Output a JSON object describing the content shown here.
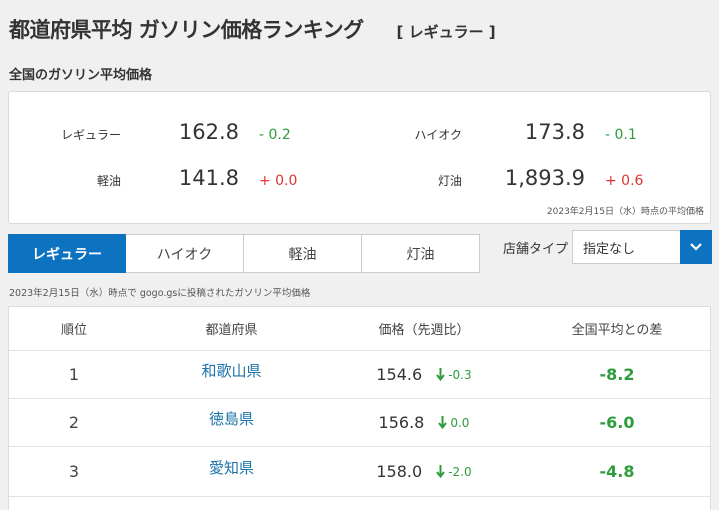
{
  "header": {
    "title": "都道府県平均 ガソリン価格ランキング",
    "tag": "[ レギュラー ]"
  },
  "summary": {
    "section_label": "全国のガソリン平均価格",
    "fuels": [
      {
        "name": "レギュラー",
        "price": "162.8",
        "diff": "- 0.2",
        "trend": "down"
      },
      {
        "name": "ハイオク",
        "price": "173.8",
        "diff": "- 0.1",
        "trend": "down"
      },
      {
        "name": "軽油",
        "price": "141.8",
        "diff": "+ 0.0",
        "trend": "up"
      },
      {
        "name": "灯油",
        "price": "1,893.9",
        "diff": "+ 0.6",
        "trend": "up"
      }
    ],
    "as_of": "2023年2月15日（水）時点の平均価格"
  },
  "tabs": [
    {
      "label": "レギュラー",
      "active": true
    },
    {
      "label": "ハイオク",
      "active": false
    },
    {
      "label": "軽油",
      "active": false
    },
    {
      "label": "灯油",
      "active": false
    }
  ],
  "shop_filter": {
    "label": "店舗タイプ",
    "selected": "指定なし"
  },
  "note": "2023年2月15日（水）時点で gogo.gsに投稿されたガソリン平均価格",
  "table": {
    "headers": [
      "順位",
      "都道府県",
      "価格（先週比）",
      "全国平均との差"
    ],
    "rows": [
      {
        "rank": "1",
        "prefecture": "和歌山県",
        "price": "154.6",
        "week_change": "-0.3",
        "diff": "-8.2"
      },
      {
        "rank": "2",
        "prefecture": "徳島県",
        "price": "156.8",
        "week_change": "0.0",
        "diff": "-6.0"
      },
      {
        "rank": "3",
        "prefecture": "愛知県",
        "price": "158.0",
        "week_change": "-2.0",
        "diff": "-4.8"
      }
    ]
  },
  "colors": {
    "accent": "#0d72bf",
    "decrease": "#2e9c3d",
    "increase": "#dd3333",
    "link": "#1a73a8"
  },
  "icons": {
    "select_arrow": "chevron-down-icon",
    "week_change": "arrow-down-icon"
  }
}
